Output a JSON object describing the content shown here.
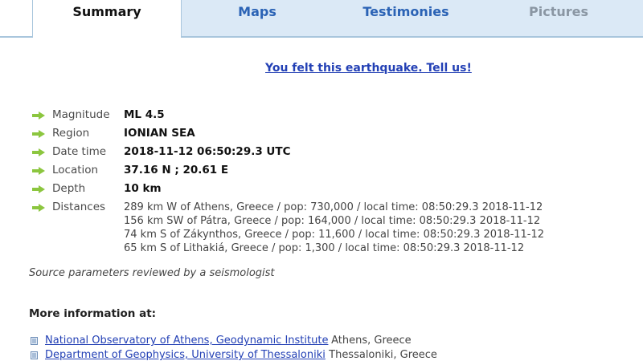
{
  "tabs": [
    {
      "label": "Summary",
      "active": true
    },
    {
      "label": "Maps"
    },
    {
      "label": "Testimonies"
    },
    {
      "label": "Pictures",
      "disabled": true
    }
  ],
  "felt_link": "You felt this earthquake. Tell us!",
  "parameters": {
    "magnitude": {
      "label": "Magnitude",
      "value": "ML 4.5"
    },
    "region": {
      "label": "Region",
      "value": "IONIAN SEA"
    },
    "datetime": {
      "label": "Date time",
      "value": "2018-11-12 06:50:29.3 UTC"
    },
    "location": {
      "label": "Location",
      "value": "37.16 N ; 20.61 E"
    },
    "depth": {
      "label": "Depth",
      "value": "10 km"
    },
    "distances": {
      "label": "Distances",
      "lines": [
        "289 km W of Athens, Greece / pop: 730,000 / local time: 08:50:29.3 2018-11-12",
        "156 km SW of Pátra, Greece / pop: 164,000 / local time: 08:50:29.3 2018-11-12",
        "74 km S of Zákynthos, Greece / pop: 11,600 / local time: 08:50:29.3 2018-11-12",
        "65 km S of Lithakiá, Greece / pop: 1,300 / local time: 08:50:29.3 2018-11-12"
      ]
    }
  },
  "source_note": "Source parameters reviewed by a seismologist",
  "more_info": {
    "title": "More information at:",
    "links": [
      {
        "name": "National Observatory of Athens, Geodynamic Institute",
        "place": " Athens, Greece"
      },
      {
        "name": "Department of Geophysics, University of Thessaloniki",
        "place": " Thessaloniki, Greece"
      }
    ]
  },
  "colors": {
    "arrow_green": "#8cc63f",
    "link_blue": "#2340b5",
    "tab_blue": "#2b63b5",
    "tab_bg": "#dbe9f6"
  },
  "icons": {
    "arrow": "right-arrow-icon",
    "bullet": "document-bullet-icon"
  }
}
